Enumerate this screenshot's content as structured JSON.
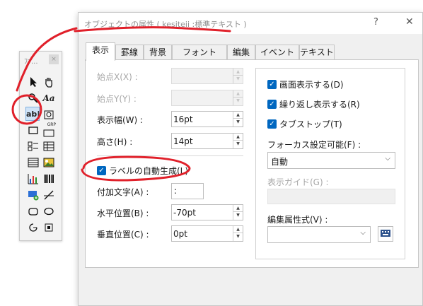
{
  "toolbox": {
    "title": "ﾌｧ...",
    "close": "×",
    "text_tool": "Aa",
    "label_tool": "ab|",
    "group_tool": "GRP"
  },
  "dialog": {
    "title": "オブジェクトの属性 ( kesiteii :標準テキスト )",
    "help": "?",
    "close": "✕"
  },
  "tabs": [
    "表示",
    "罫線",
    "背景",
    "フォント",
    "編集",
    "イベント",
    "テキスト"
  ],
  "left": {
    "start_x_label": "始点X(X) :",
    "start_y_label": "始点Y(Y) :",
    "width_label": "表示幅(W) :",
    "width_value": "16pt",
    "height_label": "高さ(H) :",
    "height_value": "14pt",
    "auto_label_checkbox": "ラベルの自動生成(L)",
    "append_text_label": "付加文字(A) :",
    "append_text_value": ":",
    "h_pos_label": "水平位置(B) :",
    "h_pos_value": "-70pt",
    "v_pos_label": "垂直位置(C) :",
    "v_pos_value": "0pt"
  },
  "right": {
    "show_on_screen": "画面表示する(D)",
    "repeat_display": "繰り返し表示する(R)",
    "tab_stop": "タブストップ(T)",
    "focus_label": "フォーカス設定可能(F) :",
    "focus_value": "自動",
    "guide_label": "表示ガイド(G) :",
    "edit_attr_label": "編集属性式(V) :"
  },
  "colors": {
    "checkbox_accent": "#0067c0",
    "annotation": "#e0202a"
  }
}
